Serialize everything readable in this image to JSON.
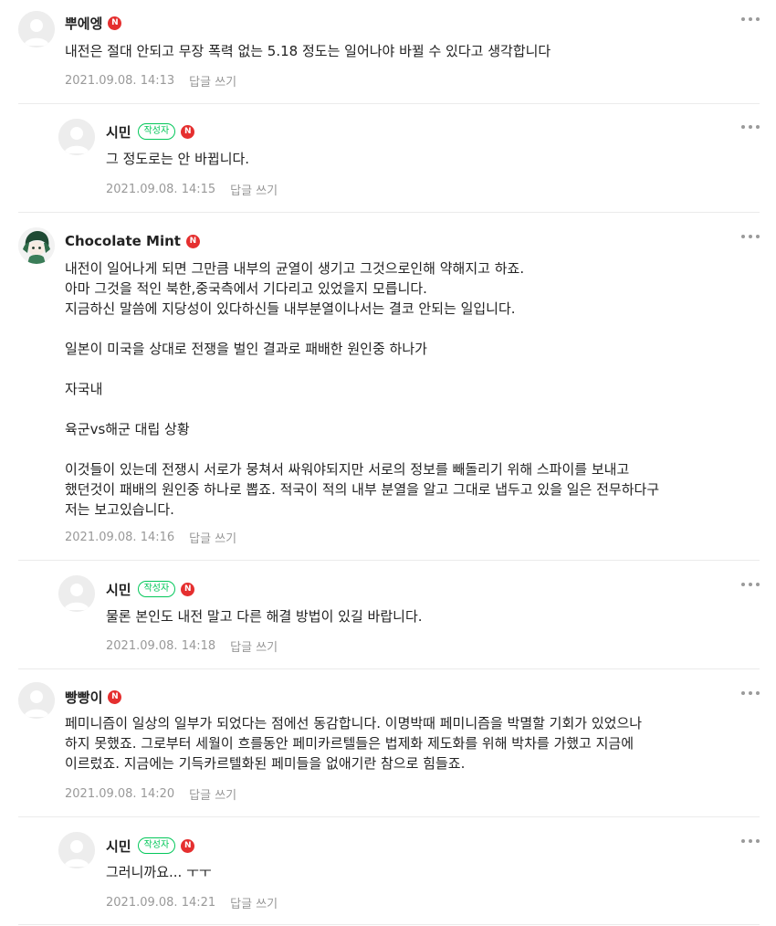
{
  "labels": {
    "writer_badge": "작성자",
    "n_badge": "N",
    "reply": "답글 쓰기"
  },
  "comments": [
    {
      "nickname": "뿌에엥",
      "is_reply": false,
      "is_writer": false,
      "avatar": "default",
      "lines": [
        "내전은 절대 안되고 무장 폭력 없는 5.18 정도는 일어나야 바뀔 수 있다고 생각합니다"
      ],
      "date": "2021.09.08. 14:13"
    },
    {
      "nickname": "시민",
      "is_reply": true,
      "is_writer": true,
      "avatar": "default",
      "lines": [
        "그 정도로는 안 바뀝니다."
      ],
      "date": "2021.09.08. 14:15"
    },
    {
      "nickname": "Chocolate Mint",
      "is_reply": false,
      "is_writer": false,
      "avatar": "character",
      "lines": [
        "내전이 일어나게 되면 그만큼 내부의 균열이 생기고 그것으로인해 약해지고 하죠.",
        "아마 그것을 적인 북한,중국측에서 기다리고 있었을지 모릅니다.",
        "지금하신 말씀에 지당성이 있다하신들 내부분열이나서는 결코 안되는 일입니다.",
        "",
        "일본이 미국을 상대로 전쟁을 벌인 결과로 패배한 원인중 하나가",
        "",
        "자국내",
        "",
        "육군vs해군 대립 상황",
        "",
        "이것들이 있는데 전쟁시 서로가 뭉쳐서 싸워야되지만 서로의 정보를 빼돌리기 위해 스파이를 보내고",
        "했던것이 패배의 원인중 하나로 뽑죠. 적국이 적의 내부 분열을 알고 그대로 냅두고 있을 일은 전무하다구",
        "저는 보고있습니다."
      ],
      "date": "2021.09.08. 14:16"
    },
    {
      "nickname": "시민",
      "is_reply": true,
      "is_writer": true,
      "avatar": "default",
      "lines": [
        "물론 본인도 내전 말고 다른 해결 방법이 있길 바랍니다."
      ],
      "date": "2021.09.08. 14:18"
    },
    {
      "nickname": "빵빵이",
      "is_reply": false,
      "is_writer": false,
      "avatar": "default",
      "lines": [
        "페미니즘이 일상의 일부가 되었다는 점에선 동감합니다. 이명박때 페미니즘을 박멸할 기회가 있었으나",
        "하지 못했죠. 그로부터 세월이 흐를동안 페미카르텔들은 법제화 제도화를 위해 박차를 가했고 지금에",
        "이르렀죠. 지금에는 기득카르텔화된 페미들을 없애기란 참으로 힘들죠."
      ],
      "date": "2021.09.08. 14:20"
    },
    {
      "nickname": "시민",
      "is_reply": true,
      "is_writer": true,
      "avatar": "default",
      "lines": [
        "그러니까요... ㅜㅜ"
      ],
      "date": "2021.09.08. 14:21"
    }
  ]
}
